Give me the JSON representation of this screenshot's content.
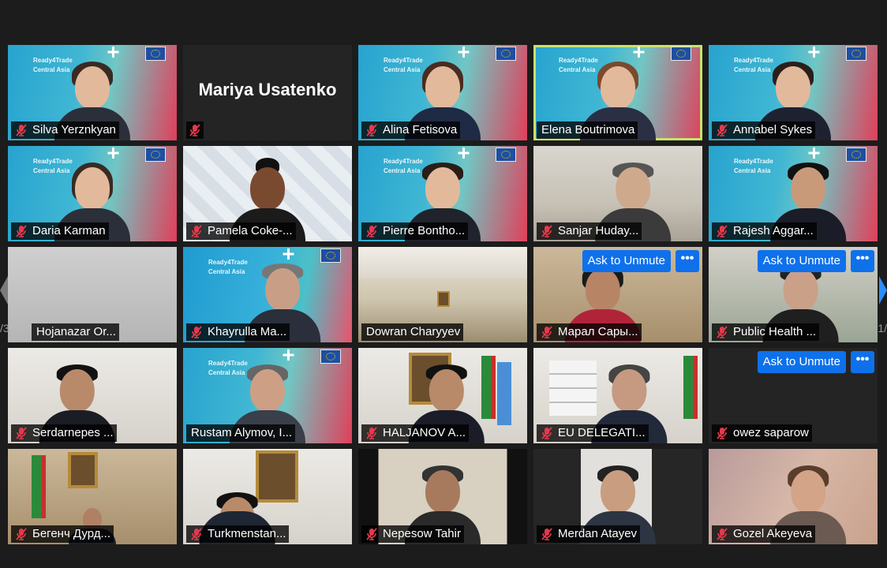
{
  "colors": {
    "background": "#1c1c1c",
    "active_border": "#c8e36b",
    "unmute_button": "#0e71eb",
    "muted_icon": "#e5394b",
    "next_arrow": "#2d8cff"
  },
  "branding": {
    "line1": "Ready4Trade",
    "line2": "Central Asia"
  },
  "pagination": {
    "left_page": "/3",
    "right_page": "1/"
  },
  "tiles": [
    {
      "name": "Silva Yerznkyan",
      "muted": true
    },
    {
      "name": "Mariya Usatenko",
      "muted": true,
      "video": false
    },
    {
      "name": "Alina Fetisova",
      "muted": true
    },
    {
      "name": "Elena Boutrimova",
      "muted": false,
      "active_speaker": true
    },
    {
      "name": "Annabel Sykes",
      "muted": true
    },
    {
      "name": "Daria Karman",
      "muted": true
    },
    {
      "name": "Pamela Coke-...",
      "muted": true
    },
    {
      "name": "Pierre Bontho...",
      "muted": true
    },
    {
      "name": "Sanjar Huday...",
      "muted": true
    },
    {
      "name": "Rajesh Aggar...",
      "muted": true
    },
    {
      "name": "Hojanazar Or...",
      "muted": false
    },
    {
      "name": "Khayrulla Ma...",
      "muted": true
    },
    {
      "name": "Dowran Charyyev",
      "muted": false
    },
    {
      "name": "Марал Сары...",
      "muted": true,
      "ask_to_unmute": "Ask to Unmute",
      "more": "•••"
    },
    {
      "name": "Public Health ...",
      "muted": true,
      "ask_to_unmute": "Ask to Unmute",
      "more": "•••"
    },
    {
      "name": "Serdarnepes ...",
      "muted": true
    },
    {
      "name": "Rustam Alymov, I...",
      "muted": false
    },
    {
      "name": "HALJANOV A...",
      "muted": true
    },
    {
      "name": "EU DELEGATI...",
      "muted": true
    },
    {
      "name": "owez saparow",
      "muted": true,
      "video": false,
      "ask_to_unmute": "Ask to Unmute",
      "more": "•••"
    },
    {
      "name": "Бегенч Дурд...",
      "muted": true
    },
    {
      "name": "Turkmenstan...",
      "muted": true
    },
    {
      "name": "Nepesow Tahir",
      "muted": true
    },
    {
      "name": "Merdan Atayev",
      "muted": true
    },
    {
      "name": "Gozel Akeyeva",
      "muted": true
    }
  ]
}
